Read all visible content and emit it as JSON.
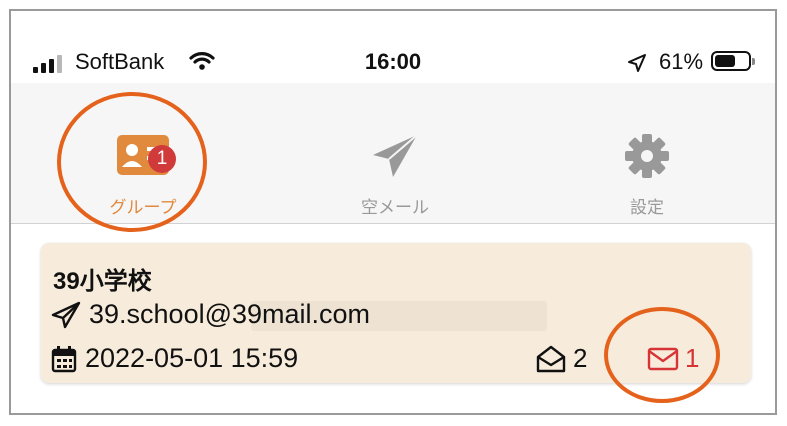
{
  "status": {
    "carrier": "SoftBank",
    "time": "16:00",
    "battery": "61%",
    "battery_level": 0.61
  },
  "tabs": [
    {
      "label": "グループ",
      "icon": "group-card-icon",
      "active": true,
      "badge": "1"
    },
    {
      "label": "空メール",
      "icon": "paper-plane-icon",
      "active": false
    },
    {
      "label": "設定",
      "icon": "gear-icon",
      "active": false
    }
  ],
  "card": {
    "title": "39小学校",
    "email": "39.school@39mail.com",
    "datetime": "2022-05-01 15:59",
    "opened_count": "2",
    "unread_count": "1"
  },
  "colors": {
    "accent": "#e18a3e",
    "badge": "#d13a3a",
    "card_bg": "#f7ecdc",
    "unread": "#d73535",
    "annotation": "#e4621b"
  }
}
